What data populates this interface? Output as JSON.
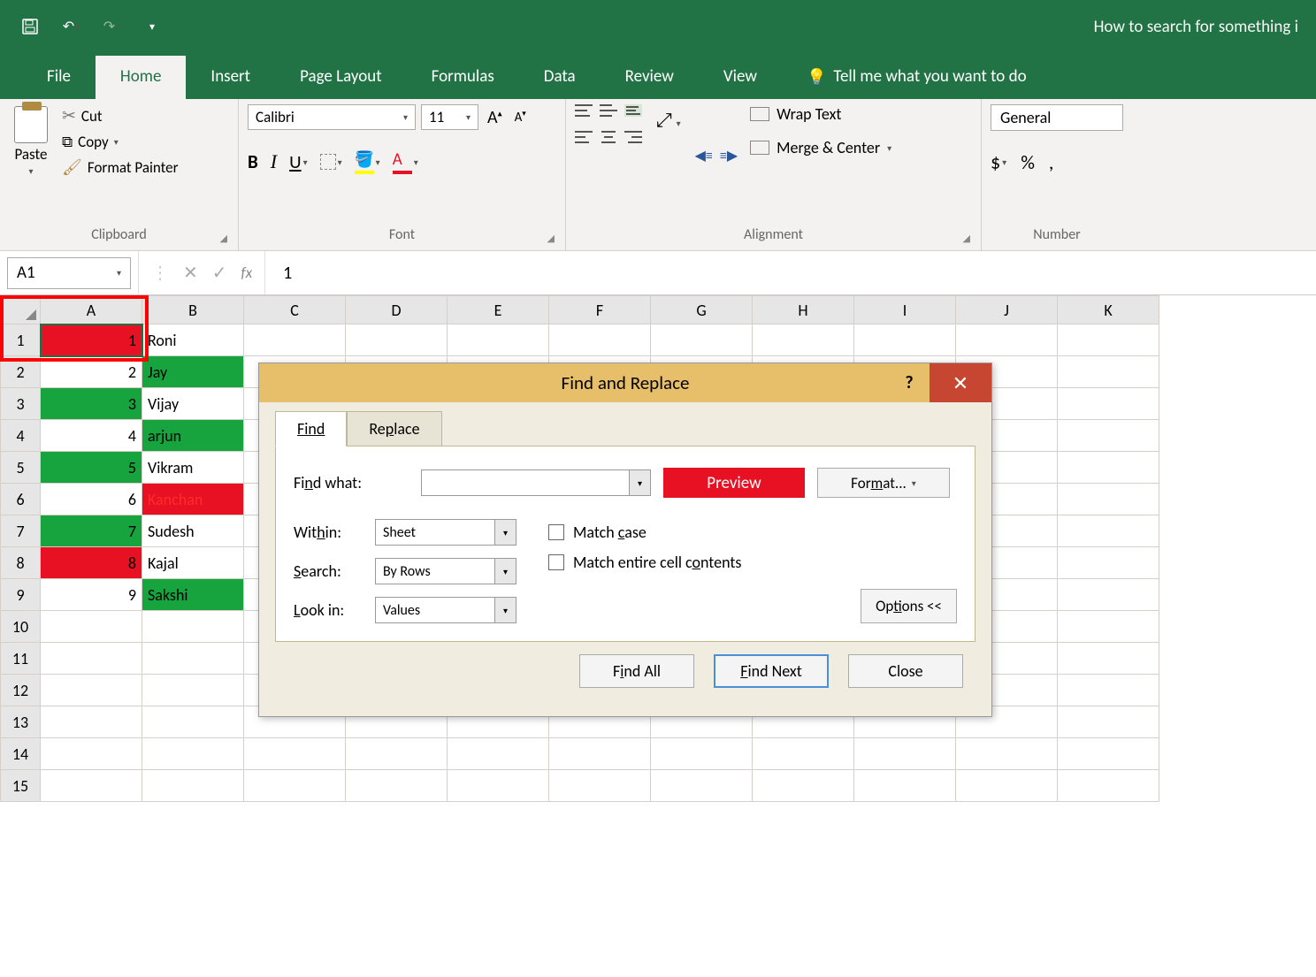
{
  "titlebar": {
    "title": "How to search for something i"
  },
  "tabs": {
    "file": "File",
    "home": "Home",
    "insert": "Insert",
    "pagelayout": "Page Layout",
    "formulas": "Formulas",
    "data": "Data",
    "review": "Review",
    "view": "View",
    "tellme": "Tell me what you want to do"
  },
  "ribbon": {
    "clipboard": {
      "paste": "Paste",
      "cut": "Cut",
      "copy": "Copy",
      "formatpainter": "Format Painter",
      "label": "Clipboard"
    },
    "font": {
      "name": "Calibri",
      "size": "11",
      "label": "Font"
    },
    "alignment": {
      "wrap": "Wrap Text",
      "merge": "Merge & Center",
      "label": "Alignment"
    },
    "number": {
      "format": "General",
      "label": "Number"
    }
  },
  "formulaBar": {
    "name": "A1",
    "value": "1",
    "fx": "fx"
  },
  "columns": [
    "A",
    "B",
    "C",
    "D",
    "E",
    "F",
    "G",
    "H",
    "I",
    "J",
    "K"
  ],
  "rows": [
    "1",
    "2",
    "3",
    "4",
    "5",
    "6",
    "7",
    "8",
    "9",
    "10",
    "11",
    "12",
    "13",
    "14",
    "15"
  ],
  "sheetData": [
    {
      "a": "1",
      "b": "Roni",
      "aStyle": "sel",
      "bStyle": "plain"
    },
    {
      "a": "2",
      "b": "Jay",
      "aStyle": "plain",
      "bStyle": "green"
    },
    {
      "a": "3",
      "b": "Vijay",
      "aStyle": "green",
      "bStyle": "plain"
    },
    {
      "a": "4",
      "b": "arjun",
      "aStyle": "plain",
      "bStyle": "green"
    },
    {
      "a": "5",
      "b": "Vikram",
      "aStyle": "green",
      "bStyle": "plain"
    },
    {
      "a": "6",
      "b": "Kanchan",
      "aStyle": "plain",
      "bStyle": "red"
    },
    {
      "a": "7",
      "b": "Sudesh",
      "aStyle": "green",
      "bStyle": "plain"
    },
    {
      "a": "8",
      "b": "Kajal",
      "aStyle": "red",
      "bStyle": "plain"
    },
    {
      "a": "9",
      "b": "Sakshi",
      "aStyle": "plain",
      "bStyle": "green"
    }
  ],
  "dialog": {
    "title": "Find and Replace",
    "tabFind": "Find",
    "tabReplace": "Replace",
    "findWhat": "Find what:",
    "findValue": "",
    "preview": "Preview",
    "format": "Format...",
    "within": "Within:",
    "withinValue": "Sheet",
    "search": "Search:",
    "searchValue": "By Rows",
    "lookin": "Look in:",
    "lookinValue": "Values",
    "matchcase": "Match case",
    "matchentire": "Match entire cell contents",
    "options": "Options <<",
    "findAll": "Find All",
    "findNext": "Find Next",
    "close": "Close"
  }
}
